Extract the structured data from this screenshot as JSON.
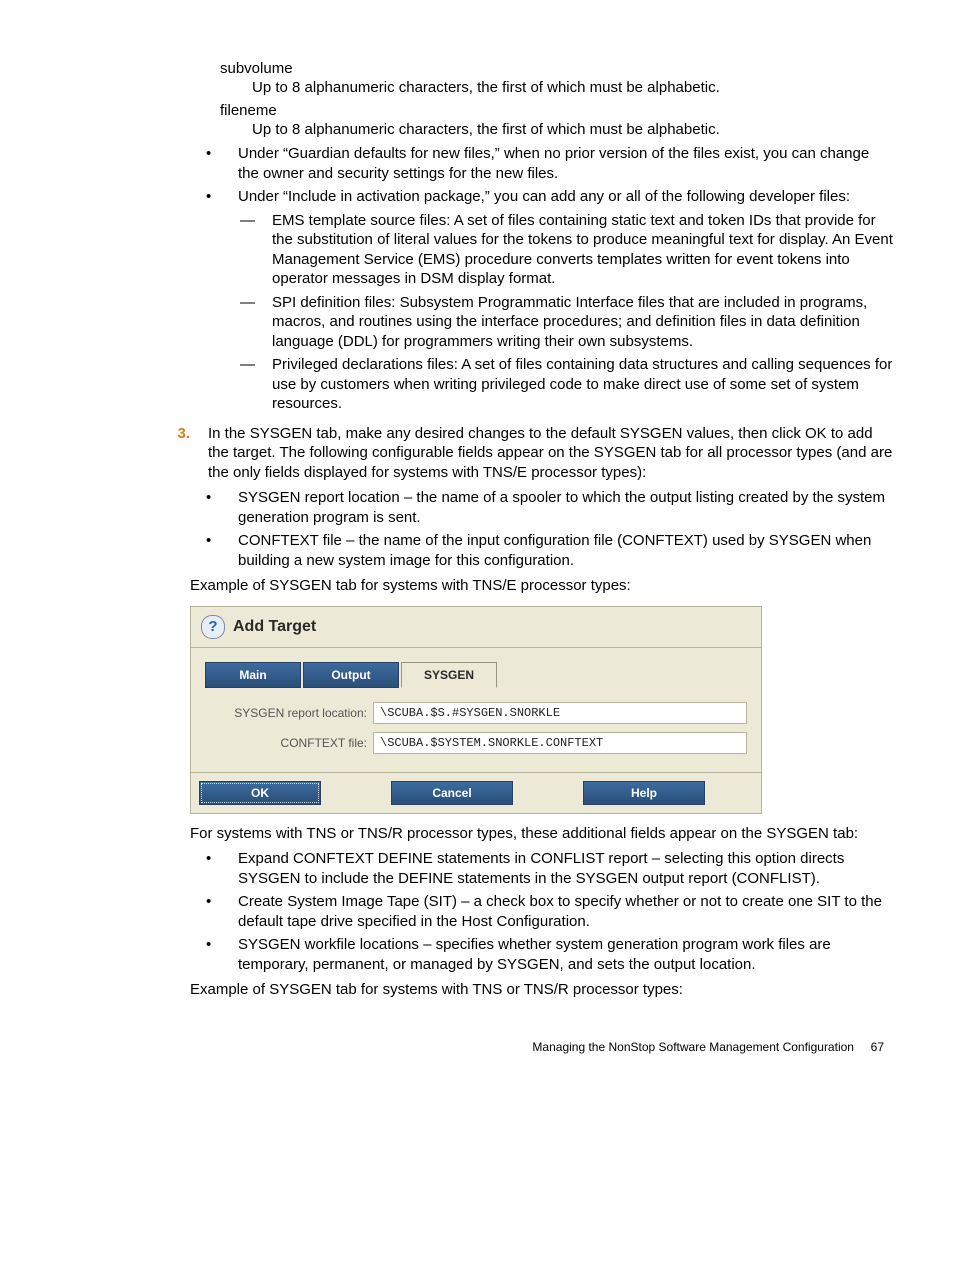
{
  "defs": {
    "subvolume_term": "subvolume",
    "subvolume_body": "Up to 8 alphanumeric characters, the first of which must be alphabetic.",
    "fileneme_term": "fileneme",
    "fileneme_body": "Up to 8 alphanumeric characters, the first of which must be alphabetic."
  },
  "bullets_top": {
    "b1": "Under “Guardian defaults for new files,” when no prior version of the files exist, you can change the owner and security settings for the new files.",
    "b2": "Under “Include in activation package,” you can add any or all of the following developer files:",
    "b2_sub": {
      "s1": "EMS template source files: A set of files containing static text and token IDs that provide for the substitution of literal values for the tokens to produce meaningful text for display. An Event Management Service (EMS) procedure converts templates written for event tokens into operator messages in DSM display format.",
      "s2": "SPI definition files: Subsystem Programmatic Interface files that are included in programs, macros, and routines using the interface procedures; and definition files in data definition language (DDL) for programmers writing their own subsystems.",
      "s3": "Privileged declarations files: A set of files containing data structures and calling sequences for use by customers when writing privileged code to make direct use of some set of system resources."
    }
  },
  "step3": {
    "num": "3.",
    "text": "In the SYSGEN tab, make any desired changes to the default SYSGEN values, then click OK to add the target. The following configurable fields appear on the SYSGEN tab for all processor types (and are the only fields displayed for systems with TNS/E processor types):",
    "sub": {
      "s1": "SYSGEN report location – the name of a spooler to which the output listing created by the system generation program is sent.",
      "s2": "CONFTEXT file – the name of the input configuration file (CONFTEXT) used by SYSGEN when building a new system image for this configuration."
    },
    "caption": "Example of SYSGEN tab for systems with TNS/E processor types:"
  },
  "dialog": {
    "title": "Add Target",
    "tabs": {
      "main": "Main",
      "output": "Output",
      "sysgen": "SYSGEN"
    },
    "fields": {
      "loc_label": "SYSGEN report location:",
      "loc_value": "\\SCUBA.$S.#SYSGEN.SNORKLE",
      "conf_label": "CONFTEXT file:",
      "conf_value": "\\SCUBA.$SYSTEM.SNORKLE.CONFTEXT"
    },
    "buttons": {
      "ok": "OK",
      "cancel": "Cancel",
      "help": "Help"
    }
  },
  "after": {
    "para": "For systems with TNS or TNS/R processor types, these additional fields appear on the SYSGEN tab:",
    "b1": "Expand CONFTEXT DEFINE statements in CONFLIST report – selecting this option directs SYSGEN to include the DEFINE statements in the SYSGEN output report (CONFLIST).",
    "b2": "Create System Image Tape (SIT) – a check box to specify whether or not to create one SIT to the default tape drive specified in the Host Configuration.",
    "b3": "SYSGEN workfile locations – specifies whether system generation program work files are temporary, permanent, or managed by SYSGEN, and sets the output location.",
    "caption2": "Example of SYSGEN tab for systems with TNS or TNS/R processor types:"
  },
  "footer": {
    "section": "Managing the NonStop Software Management Configuration",
    "page": "67"
  }
}
